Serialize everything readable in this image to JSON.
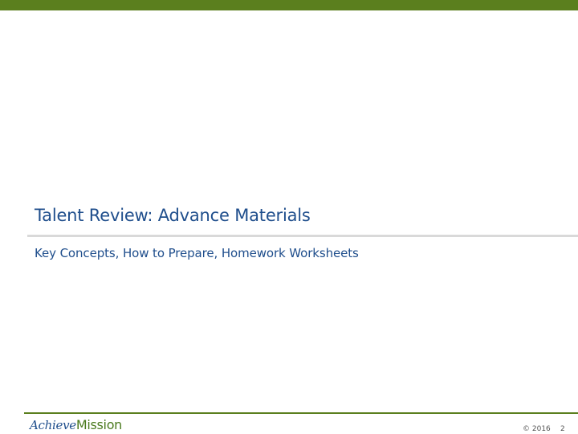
{
  "slide": {
    "title": "Talent Review: Advance Materials",
    "subtitle": "Key Concepts, How to Prepare, Homework Worksheets"
  },
  "footer": {
    "logo_part1": "Achieve",
    "logo_part2": "Mission",
    "copyright": "© 2016",
    "page_number": "2"
  },
  "colors": {
    "accent_green": "#5b7f1e",
    "title_blue": "#1f4e8c",
    "divider_gray": "#d9d9d9"
  }
}
